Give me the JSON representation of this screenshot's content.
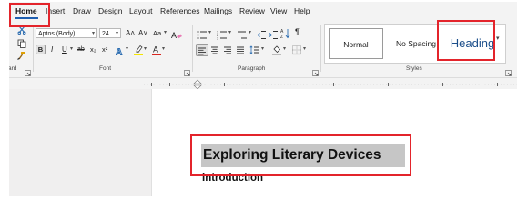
{
  "menu": {
    "tabs": [
      "Home",
      "Insert",
      "Draw",
      "Design",
      "Layout",
      "References",
      "Mailings",
      "Review",
      "View",
      "Help"
    ]
  },
  "ribbon": {
    "clipboard": {
      "label_partial": "ard"
    },
    "font": {
      "font_name": "Aptos (Body)",
      "font_size": "24",
      "grow": "A˄",
      "shrink": "A˅",
      "change_case": "Aa",
      "bold": "B",
      "italic": "I",
      "underline": "U",
      "strike": "ab",
      "subscript": "x₂",
      "superscript": "x²",
      "label": "Font"
    },
    "paragraph": {
      "label": "Paragraph"
    },
    "styles": {
      "normal": "Normal",
      "no_spacing": "No Spacing",
      "heading": "Heading",
      "label": "Styles"
    }
  },
  "document": {
    "title": "Exploring Literary Devices",
    "subheading": "Introduction"
  },
  "colors": {
    "annotation": "#e3242b",
    "heading_style": "#1b4e8a",
    "highlight_yellow": "#f5e500",
    "font_color_red": "#d7261f"
  }
}
